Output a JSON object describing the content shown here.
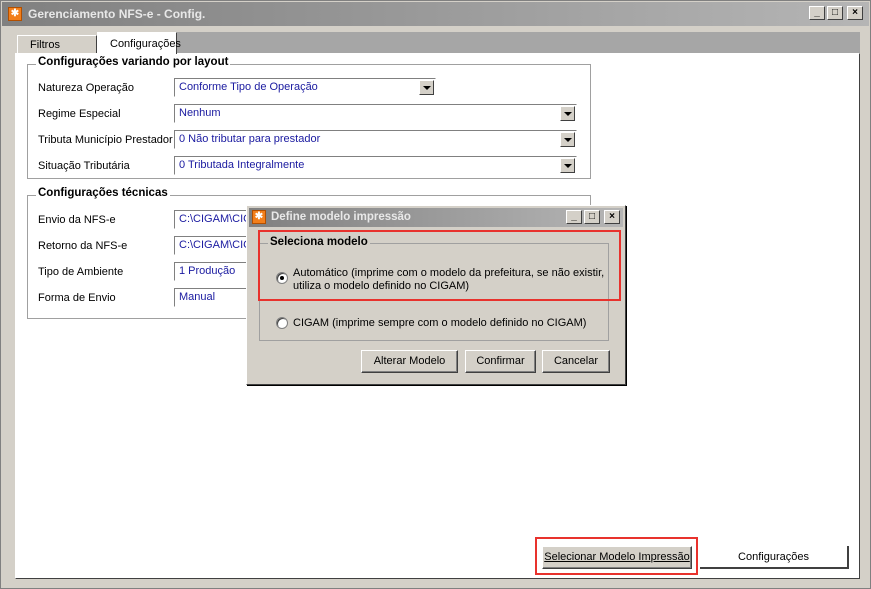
{
  "window": {
    "title": "Gerenciamento NFS-e - Config.",
    "icon": "cigam-icon",
    "controls": {
      "minimize": "_",
      "maximize": "□",
      "close": "×"
    }
  },
  "tabs": [
    {
      "label": "Filtros",
      "active": false
    },
    {
      "label": "Configurações",
      "active": true
    }
  ],
  "layout_group": {
    "title": "Configurações variando por layout",
    "rows": [
      {
        "label": "Natureza Operação",
        "value": "Conforme Tipo de Operação"
      },
      {
        "label": "Regime Especial",
        "value": "Nenhum"
      },
      {
        "label": "Tributa Município Prestador",
        "value": "0 Não tributar para prestador"
      },
      {
        "label": "Situação Tributária",
        "value": "0  Tributada Integralmente"
      }
    ]
  },
  "tech_group": {
    "title": "Configurações técnicas",
    "rows": [
      {
        "label": "Envio da NFS-e",
        "value": "C:\\CIGAM\\CIG"
      },
      {
        "label": "Retorno da NFS-e",
        "value": "C:\\CIGAM\\CIG"
      },
      {
        "label": "Tipo de Ambiente",
        "value": "1 Produção"
      },
      {
        "label": "Forma de Envio",
        "value": "Manual"
      }
    ]
  },
  "bottom_buttons": {
    "select_model": "Selecionar Modelo Impressão",
    "settings": "Configurações"
  },
  "dialog": {
    "title": "Define modelo impressão",
    "group_title": "Seleciona modelo",
    "options": [
      {
        "label": "Automático (imprime com o modelo da prefeitura, se não existir,",
        "label2": "utiliza o modelo definido no CIGAM)",
        "checked": true
      },
      {
        "label": "CIGAM (imprime sempre com o modelo definido no CIGAM)",
        "checked": false
      }
    ],
    "buttons": {
      "change": "Alterar Modelo",
      "confirm": "Confirmar",
      "cancel": "Cancelar"
    }
  },
  "colors": {
    "highlight": "#e8322d",
    "field_text": "#1a1aa0",
    "titlebar": "#808080"
  }
}
